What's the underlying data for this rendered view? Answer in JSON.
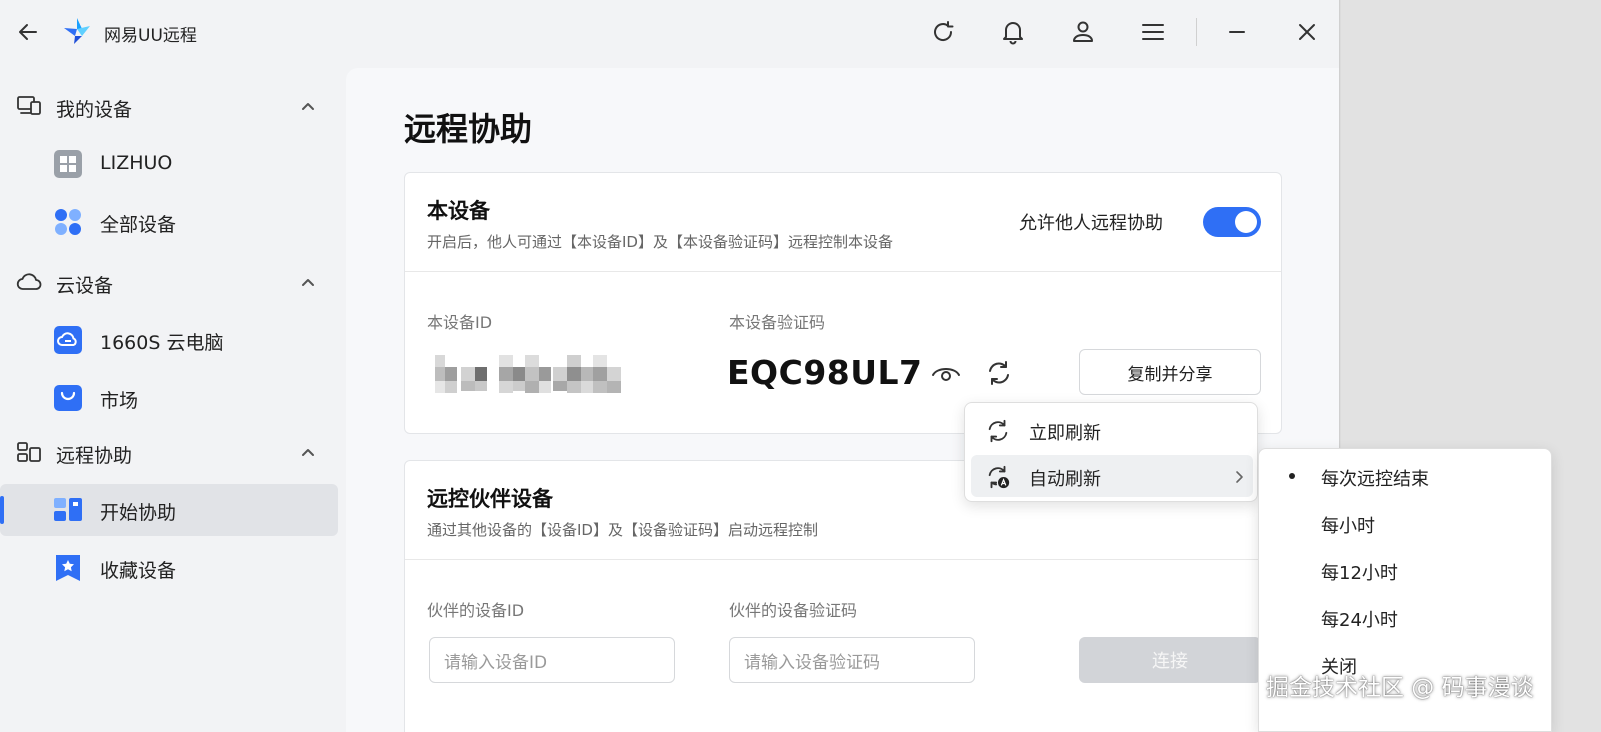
{
  "app": {
    "title": "网易UU远程"
  },
  "sidebar": {
    "groups": [
      {
        "label": "我的设备",
        "items": [
          {
            "label": "LIZHUO"
          },
          {
            "label": "全部设备"
          }
        ]
      },
      {
        "label": "云设备",
        "items": [
          {
            "label": "1660S 云电脑"
          },
          {
            "label": "市场"
          }
        ]
      },
      {
        "label": "远程协助",
        "items": [
          {
            "label": "开始协助",
            "active": true
          },
          {
            "label": "收藏设备"
          }
        ]
      }
    ]
  },
  "main": {
    "title": "远程协助",
    "this_device": {
      "title": "本设备",
      "subtitle": "开启后，他人可通过【本设备ID】及【本设备验证码】远程控制本设备",
      "toggle_label": "允许他人远程协助",
      "toggle_on": true,
      "id_label": "本设备ID",
      "code_label": "本设备验证码",
      "code_value": "EQC98UL7",
      "share_button": "复制并分享"
    },
    "partner": {
      "title": "远控伙伴设备",
      "subtitle": "通过其他设备的【设备ID】及【设备验证码】启动远程控制",
      "id_label": "伙伴的设备ID",
      "code_label": "伙伴的设备验证码",
      "id_placeholder": "请输入设备ID",
      "code_placeholder": "请输入设备验证码",
      "connect_button": "连接"
    }
  },
  "context_menu": {
    "items": [
      {
        "label": "立即刷新"
      },
      {
        "label": "自动刷新"
      }
    ]
  },
  "submenu": {
    "items": [
      {
        "label": "每次远控结束",
        "selected": true
      },
      {
        "label": "每小时"
      },
      {
        "label": "每12小时"
      },
      {
        "label": "每24小时"
      },
      {
        "label": "关闭"
      }
    ]
  },
  "watermark": "掘金技术社区 @ 码事漫谈",
  "colors": {
    "accent": "#2f6ff5",
    "sidebar_bg": "#f2f3f5",
    "main_bg": "#f7f8fa"
  }
}
